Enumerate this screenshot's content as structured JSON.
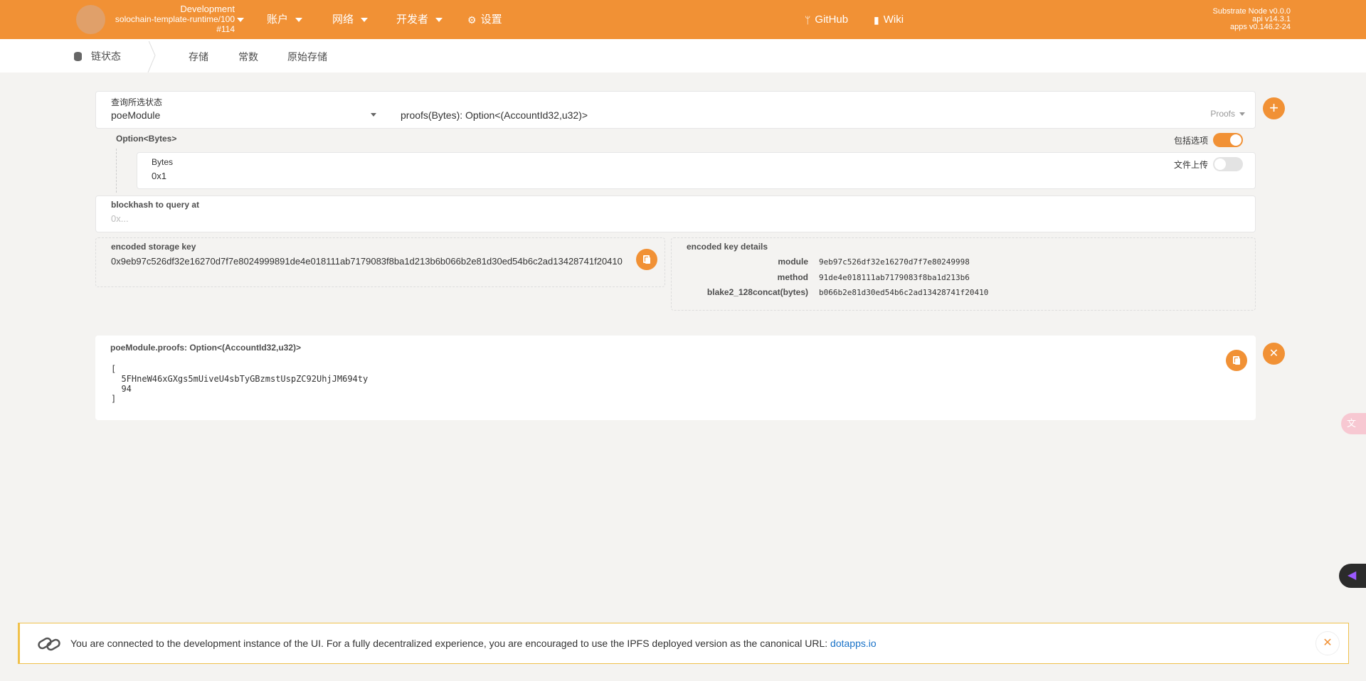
{
  "header": {
    "chain_name": "Development",
    "runtime": "solochain-template-runtime/100",
    "block": "#114",
    "menu": [
      {
        "label": "账户",
        "icon": ""
      },
      {
        "label": "网络",
        "icon": ""
      },
      {
        "label": "开发者",
        "icon": ""
      },
      {
        "label": "设置",
        "icon": "gear-icon"
      },
      {
        "label": "GitHub",
        "icon": "git-branch-icon"
      },
      {
        "label": "Wiki",
        "icon": "book-icon"
      }
    ],
    "version": {
      "node": "Substrate Node v0.0.0",
      "api": "api v14.3.1",
      "apps": "apps v0.146.2-24"
    }
  },
  "subnav": {
    "section": "链状态",
    "tabs": [
      "存储",
      "常数",
      "原始存储"
    ],
    "active_tab": "存储"
  },
  "query": {
    "label": "查询所选状态",
    "module": "poeModule",
    "method": "proofs(Bytes): Option<(AccountId32,u32)>",
    "docs_label": "Proofs"
  },
  "params": {
    "title": "Option<Bytes>",
    "bytes_label": "Bytes",
    "bytes_value": "0x1",
    "include_option_label": "包括选项",
    "include_option_on": true,
    "file_upload_label": "文件上传",
    "file_upload_on": false
  },
  "blockhash": {
    "label": "blockhash to query at",
    "placeholder": "0x..."
  },
  "encoded": {
    "key_label": "encoded storage key",
    "key_value": "0x9eb97c526df32e16270d7f7e8024999891de4e018111ab7179083f8ba1d213b6b066b2e81d30ed54b6c2ad13428741f20410",
    "details_label": "encoded key details",
    "details": [
      {
        "key": "module",
        "value": "9eb97c526df32e16270d7f7e80249998"
      },
      {
        "key": "method",
        "value": "91de4e018111ab7179083f8ba1d213b6"
      },
      {
        "key": "blake2_128concat(bytes)",
        "value": "b066b2e81d30ed54b6c2ad13428741f20410"
      }
    ]
  },
  "result": {
    "label": "poeModule.proofs: Option<(AccountId32,u32)>",
    "lines": [
      "[",
      "  5FHneW46xGXgs5mUiveU4sbTyGBzmstUspZC92UhjJM694ty",
      "  94",
      "]"
    ]
  },
  "banner": {
    "message": "You are connected to the development instance of the UI. For a fully decentralized experience, you are encouraged to use the IPFS deployed version as the canonical URL: ",
    "link": "dotapps.io"
  },
  "colors": {
    "accent": "#f19135",
    "background": "#f4f3f1",
    "link": "#1a73c8"
  }
}
